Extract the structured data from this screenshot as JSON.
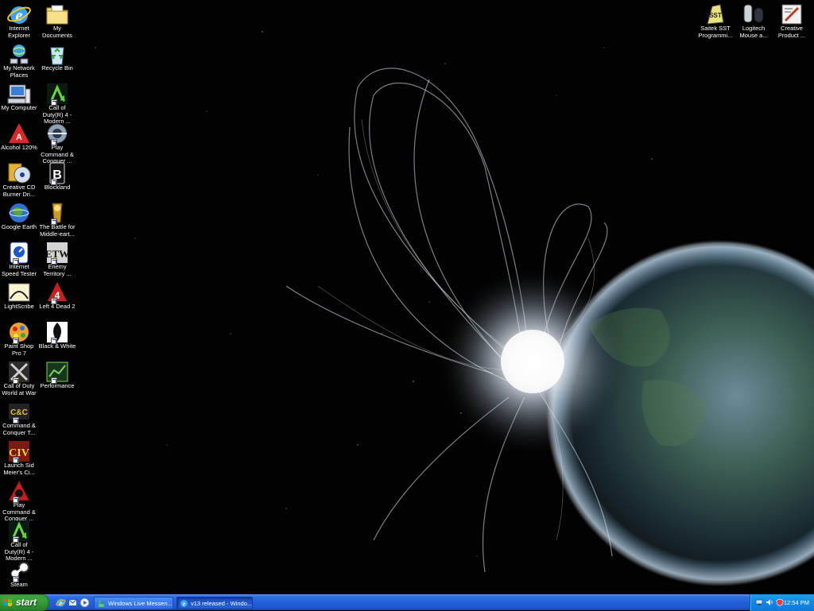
{
  "desktop": {
    "left_icons": [
      {
        "label": "Internet Explorer",
        "icon": "internet-explorer-icon",
        "shortcut": false
      },
      {
        "label": "My Documents",
        "icon": "my-documents-icon",
        "shortcut": false
      },
      {
        "label": "My Network Places",
        "icon": "my-network-places-icon",
        "shortcut": false
      },
      {
        "label": "Recycle Bin",
        "icon": "recycle-bin-icon",
        "shortcut": false
      },
      {
        "label": "My Computer",
        "icon": "my-computer-icon",
        "shortcut": false
      },
      {
        "label": "Call of Duty(R) 4 - Modern ...",
        "icon": "call-of-duty-4-icon",
        "shortcut": true
      },
      {
        "label": "Alcohol 120%",
        "icon": "alcohol-120-icon",
        "shortcut": false
      },
      {
        "label": "Play Command & Conquer ...",
        "icon": "play-command-conquer-icon",
        "shortcut": true
      },
      {
        "label": "Creative CD Burner Dri...",
        "icon": "creative-cd-burner-icon",
        "shortcut": false
      },
      {
        "label": "Blockland",
        "icon": "blockland-icon",
        "shortcut": true
      },
      {
        "label": "Google Earth",
        "icon": "google-earth-icon",
        "shortcut": false
      },
      {
        "label": "The Battle for Middle-eart...",
        "icon": "battle-for-middle-earth-icon",
        "shortcut": true
      },
      {
        "label": "Internet Speed Tester",
        "icon": "internet-speed-tester-icon",
        "shortcut": true
      },
      {
        "label": "Enemy Territory ...",
        "icon": "enemy-territory-icon",
        "shortcut": true
      },
      {
        "label": "LightScribe",
        "icon": "lightscribe-icon",
        "shortcut": false
      },
      {
        "label": "Left 4 Dead 2",
        "icon": "left-4-dead-2-icon",
        "shortcut": true
      },
      {
        "label": "Paint Shop Pro 7",
        "icon": "paint-shop-pro-icon",
        "shortcut": true
      },
      {
        "label": "Black & White",
        "icon": "black-and-white-icon",
        "shortcut": true
      },
      {
        "label": "Call of Duty World at War",
        "icon": "call-of-duty-world-at-war-icon",
        "shortcut": true
      },
      {
        "label": "Performance",
        "icon": "performance-icon",
        "shortcut": true
      },
      {
        "label": "Command & Conquer T...",
        "icon": "command-conquer-tiberian-icon",
        "shortcut": true
      },
      {
        "label": "Launch Sid Meier's Ci...",
        "icon": "civilization-icon",
        "shortcut": true
      },
      {
        "label": "Play Command & Conquer ...",
        "icon": "play-command-conquer-2-icon",
        "shortcut": true
      },
      {
        "label": "Call of Duty(R) 4 - Modern ...",
        "icon": "call-of-duty-4-2-icon",
        "shortcut": true
      },
      {
        "label": "Steam",
        "icon": "steam-icon",
        "shortcut": true
      }
    ],
    "right_icons": [
      {
        "label": "Saitek SST Programmi...",
        "icon": "saitek-sst-icon"
      },
      {
        "label": "Logitech Mouse a...",
        "icon": "logitech-mouse-icon"
      },
      {
        "label": "Creative Product ...",
        "icon": "creative-product-icon"
      }
    ]
  },
  "taskbar": {
    "start_label": "start",
    "quick_launch": [
      "internet-explorer-icon",
      "outlook-express-icon",
      "media-player-icon"
    ],
    "tasks": [
      {
        "label": "Windows Live Messen...",
        "icon": "messenger-icon",
        "active": false
      },
      {
        "label": "v13 released - Windo...",
        "icon": "internet-explorer-icon",
        "active": true
      }
    ],
    "tray_icons": [
      "network-icon",
      "volume-icon",
      "safety-icon"
    ],
    "clock": "12:54 PM"
  },
  "colors": {
    "taskbar": "#245edb",
    "start": "#37a13a",
    "tray": "#1487e3"
  }
}
